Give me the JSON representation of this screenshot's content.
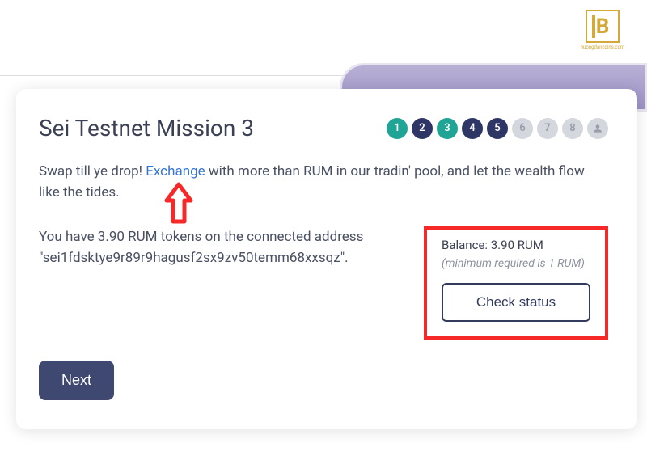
{
  "logo": {
    "text": "huongdancoins.com"
  },
  "card": {
    "title": "Sei Testnet Mission 3",
    "steps": [
      "1",
      "2",
      "3",
      "4",
      "5",
      "6",
      "7",
      "8"
    ],
    "desc_before": "Swap till ye drop! ",
    "desc_link": "Exchange",
    "desc_after": " with more than RUM in our tradin' pool, and let the wealth flow like the tides.",
    "token_info": "You have 3.90 RUM tokens on the connected address \"sei1fdsktye9r89r9hagusf2sx9zv50temm68xxsqz\".",
    "balance": {
      "label": "Balance: 3.90 RUM",
      "min": "(minimum required is 1 RUM)",
      "button": "Check status"
    },
    "next": "Next"
  }
}
